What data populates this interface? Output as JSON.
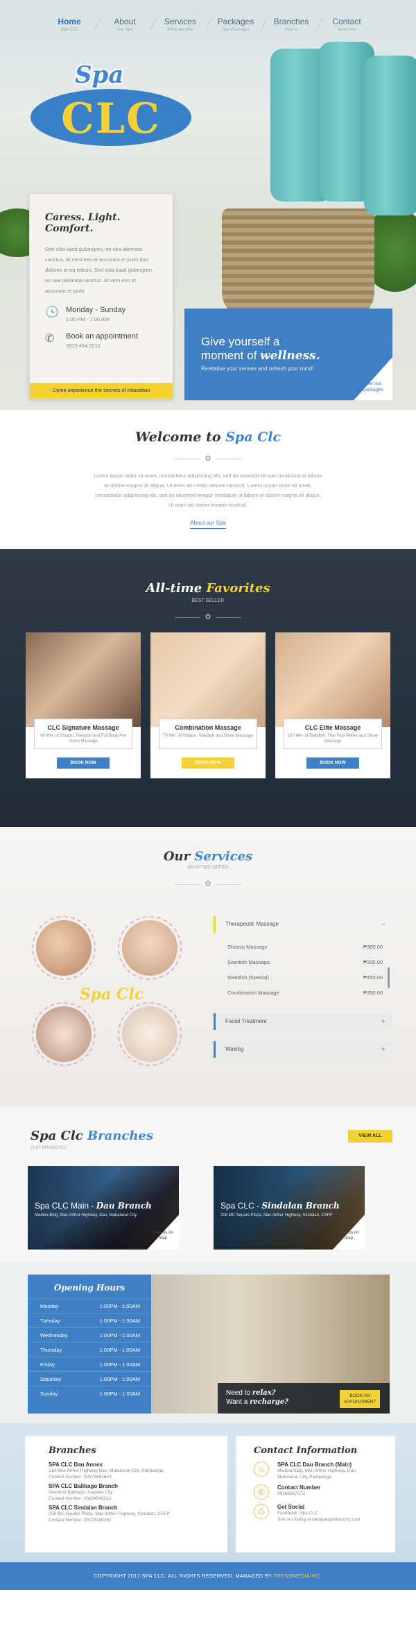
{
  "nav": [
    {
      "label": "Home",
      "sub": "Spa CLC"
    },
    {
      "label": "About",
      "sub": "Our Spa"
    },
    {
      "label": "Services",
      "sub": "What we offer"
    },
    {
      "label": "Packages",
      "sub": "Spa Packages"
    },
    {
      "label": "Branches",
      "sub": "Visit us"
    },
    {
      "label": "Contact",
      "sub": "Book now"
    }
  ],
  "logo": {
    "top": "Spa",
    "main": "CLC"
  },
  "hero_card": {
    "title": "Caress. Light. Comfort.",
    "body": "Stet clita kasd gubergren, no sea takimata sanctus. At vero eos et accusam et justo duo dolores et ea rebum. Stet clita kasd gubergren, no sea takimata sanctus. At vero eos et accusam et justo.",
    "hours_title": "Monday - Sunday",
    "hours_sub": "1:00 PM - 1:00 AM",
    "book_title": "Book an appointment",
    "book_sub": "0915 454 0212",
    "bar": "Come experience the secrets of relaxation"
  },
  "wellness": {
    "line1": "Give yourself a",
    "line2_pre": "moment of ",
    "line2_em": "wellness.",
    "line3": "Revitalise your senses and refresh your mind!",
    "see": "See our packages"
  },
  "welcome": {
    "title_pre": "Welcome to ",
    "title_em": "Spa Clc",
    "body": "Lorem ipsum dolor sit amet, consectetur adipisicing elit, sed do eiusmod tempor incididunt ut labore et dolore magna sit aliqua. Ut enim ad minim veniam nostrud. Lorem ipsum dolor sit amet, consectetur adipisicing elit, sed do eiusmod tempor incididunt ut labore et dolore magna sit aliqua. Ut enim ad minim veniam nostrud.",
    "link": "About our Spa"
  },
  "favorites": {
    "title_pre": "All-time ",
    "title_em": "Favorites",
    "sub": "BEST SELLER",
    "cards": [
      {
        "title": "CLC Signature Massage",
        "desc": "90 Min. of Shiatsu, Swedish and Full Body Hot Stone Massage",
        "btn": "BOOK NOW",
        "btn_color": "#3f7fc3"
      },
      {
        "title": "Combination Massage",
        "desc": "70 Min. of Shiatsu, Swedish and Stone Massage",
        "btn": "BOOK NOW",
        "btn_color": "#f4d233"
      },
      {
        "title": "CLC Elite Massage",
        "desc": "100 Min. of Swedish, Thai Foot Reflex and Stone Massage",
        "btn": "BOOK NOW",
        "btn_color": "#3f7fc3"
      }
    ]
  },
  "services": {
    "title_pre": "Our ",
    "title_em": "Services",
    "sub": "WHAT WE OFFER",
    "overlay": "Spa Clc",
    "open_title": "Therapeutic Massage",
    "rows": [
      {
        "name": "Shiatsu Massage",
        "price": "₱300.00"
      },
      {
        "name": "Swedish Massage",
        "price": "₱300.00"
      },
      {
        "name": "Swedish (Special)",
        "price": "₱450.00"
      },
      {
        "name": "Combination Massage",
        "price": "₱350.00"
      }
    ],
    "collapsed": [
      "Facial Treatment",
      "Waxing"
    ]
  },
  "branches": {
    "title_pre": "Spa Clc ",
    "title_em": "Branches",
    "sub": "OUR BRANCHES",
    "viewall": "VIEW ALL",
    "cards": [
      {
        "title_pre": "Spa CLC Main - ",
        "title_em": "Dau Branch",
        "addr": "Medina Bldg, Mac Arthur Highway, Dau, Mabalacat City",
        "view": "View us on map"
      },
      {
        "title_pre": "Spa CLC - ",
        "title_em": "Sindalan Branch",
        "addr": "208 MC Square Plaza, Mac Arthur Highway, Sindalan, CSFP",
        "view": "View us on map"
      }
    ]
  },
  "opening": {
    "title": "Opening Hours",
    "days": [
      {
        "day": "Monday",
        "time": "1:00PM - 1:00AM"
      },
      {
        "day": "Tuesday",
        "time": "1:00PM - 1:00AM"
      },
      {
        "day": "Wednesday",
        "time": "1:00PM - 1:00AM"
      },
      {
        "day": "Thursday",
        "time": "1:00PM - 1:00AM"
      },
      {
        "day": "Friday",
        "time": "1:00PM - 1:00AM"
      },
      {
        "day": "Saturday",
        "time": "1:00PM - 1:00AM"
      },
      {
        "day": "Sunday",
        "time": "1:00PM - 1:00AM"
      }
    ],
    "need1_pre": "Need to ",
    "need1_em": "relax?",
    "need2_pre": "Want a ",
    "need2_em": "recharge?",
    "btn": "BOOK AN APPOINTMENT"
  },
  "contact": {
    "branches_title": "Branches",
    "branches": [
      {
        "name": "SPA CLC Dau Annex",
        "addr": "216 Mac Arthur Highway Dau, Mabalacat City, Pampanga",
        "phone": "Contact Number: 09175851643"
      },
      {
        "name": "SPA CLC Balibago Branch",
        "addr": "Severina Balibago, Angeles City",
        "phone": "Contact Number: 09154540212"
      },
      {
        "name": "SPA CLC Sindalan Branch",
        "addr": "208 MC Square Plaza, Mac Arthur Highway, Sindalan, CSFP",
        "phone": "Contact Number: 09178180252"
      }
    ],
    "info_title": "Contact Information",
    "info": [
      {
        "icon": "home-icon",
        "glyph": "⌂",
        "name": "SPA CLC Dau Branch (Main)",
        "d1": "Medina Bldg, Mac Arthur Highway, Dau,",
        "d2": "Mabalacat City, Pampanga"
      },
      {
        "icon": "phone-icon",
        "glyph": "✆",
        "name": "Contact Number",
        "d1": "09266657573",
        "d2": ""
      },
      {
        "icon": "social-icon",
        "glyph": "♺",
        "name": "Get Social",
        "d1": "Facebook: Spa CLC",
        "d2": "See our listing at pampangadirectory.com"
      }
    ]
  },
  "footer": {
    "text": "COPYRIGHT 2017 SPA CLC. ALL RIGHTS RESERVED. MANAGED BY ",
    "em": "TRENDMEDIA INC."
  }
}
